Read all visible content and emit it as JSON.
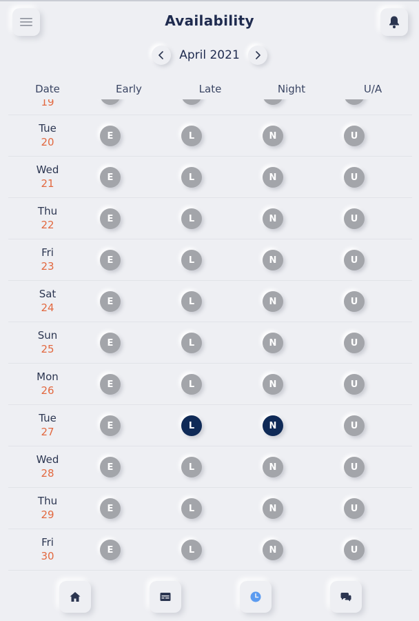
{
  "header": {
    "title": "Availability",
    "menu_icon": "hamburger-menu-icon",
    "notification_icon": "bell-icon"
  },
  "month_nav": {
    "label": "April 2021",
    "prev_icon": "chevron-left-icon",
    "next_icon": "chevron-right-icon"
  },
  "columns": [
    "Date",
    "Early",
    "Late",
    "Night",
    "U/A"
  ],
  "shift_codes": [
    "E",
    "L",
    "N",
    "U"
  ],
  "colors": {
    "background": "#eeeff3",
    "date_number": "#e2683f",
    "shift_unselected": "#a3a5aa",
    "shift_selected": "#0f2a57",
    "active_tab": "#5b9bf0"
  },
  "partial_row": {
    "date": "19"
  },
  "rows": [
    {
      "dow": "Tue",
      "date": "20",
      "selected": []
    },
    {
      "dow": "Wed",
      "date": "21",
      "selected": []
    },
    {
      "dow": "Thu",
      "date": "22",
      "selected": []
    },
    {
      "dow": "Fri",
      "date": "23",
      "selected": []
    },
    {
      "dow": "Sat",
      "date": "24",
      "selected": []
    },
    {
      "dow": "Sun",
      "date": "25",
      "selected": []
    },
    {
      "dow": "Mon",
      "date": "26",
      "selected": []
    },
    {
      "dow": "Tue",
      "date": "27",
      "selected": [
        "L",
        "N"
      ]
    },
    {
      "dow": "Wed",
      "date": "28",
      "selected": []
    },
    {
      "dow": "Thu",
      "date": "29",
      "selected": []
    },
    {
      "dow": "Fri",
      "date": "30",
      "selected": []
    }
  ],
  "bottom_nav": [
    {
      "name": "home",
      "icon": "home-icon",
      "active": false
    },
    {
      "name": "schedule",
      "icon": "calendar-icon",
      "active": false
    },
    {
      "name": "availability",
      "icon": "clock-icon",
      "active": true
    },
    {
      "name": "messages",
      "icon": "chat-icon",
      "active": false
    }
  ]
}
